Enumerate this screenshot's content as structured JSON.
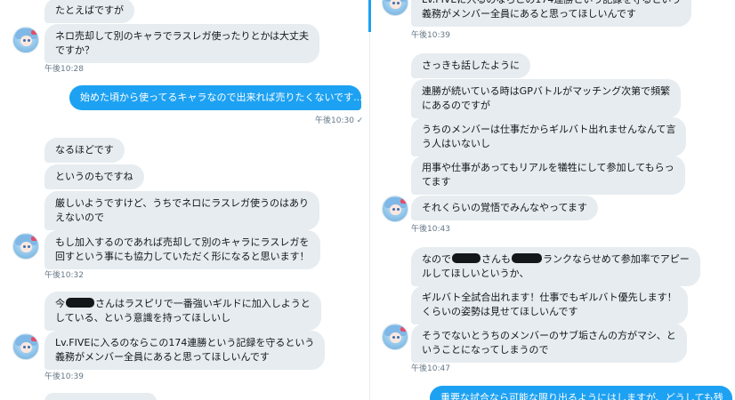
{
  "left_pane": {
    "messages": [
      {
        "lines": [
          "たとえばですが"
        ]
      },
      {
        "lines": [
          "ネロ売却して別のキャラでラスレガ使ったりとかは大丈夫",
          "ですか？"
        ]
      },
      {
        "time": "午後10:28"
      },
      {
        "lines": [
          "始めた頃から使ってるキャラなので出来れば売りたくないです..."
        ]
      },
      {
        "time": "午後10:30 ✓"
      },
      {
        "lines": [
          "なるほどです"
        ]
      },
      {
        "lines": [
          "というのもですね"
        ]
      },
      {
        "lines": [
          "厳しいようですけど、うちでネロにラスレガ使うのはあり",
          "えないので"
        ]
      },
      {
        "lines": [
          "もし加入するのであれば売却して別のキャラにラスレガを",
          "回すという事にも協力していただく形になると思います！"
        ]
      },
      {
        "time": "午後10:32"
      },
      {
        "line1_prefix": "今",
        "line1_suffix": "さんはラスピリで一番強いギルドに加入しようと",
        "line2": "している、という意識を持ってほしいし"
      },
      {
        "lines": [
          "Lv.FIVEに入るのならこの174連勝という記録を守るという",
          "義務がメンバー全員にあると思ってほしいんです"
        ]
      },
      {
        "time": "午後10:39"
      }
    ]
  },
  "right_pane": {
    "messages": [
      {
        "lines": [
          "Lv.FIVEに入るのならこの174連勝という記録を守るという",
          "義務がメンバー全員にあると思ってほしいんです"
        ]
      },
      {
        "time": "午後10:39"
      },
      {
        "lines": [
          "さっきも話したように"
        ]
      },
      {
        "lines": [
          "連勝が続いている時はGPバトルがマッチング次第で頻繁",
          "にあるのですが"
        ]
      },
      {
        "lines": [
          "うちのメンバーは仕事だからギルバト出れませんなんて言",
          "う人はいないし"
        ]
      },
      {
        "lines": [
          "用事や仕事があってもリアルを犠牲にして参加してもらっ",
          "てます"
        ]
      },
      {
        "lines": [
          "それくらいの覚悟でみんなやってます"
        ]
      },
      {
        "time": "午後10:43"
      },
      {
        "line1_prefix": "なので",
        "line1_mid": "さんも",
        "line1_suffix": "ランクならせめて参加率でアピー",
        "line2": "ルしてほしいというか、"
      },
      {
        "lines": [
          "ギルバト全試合出れます！仕事でもギルバト優先します！",
          "くらいの姿勢は見せてほしいんです"
        ]
      },
      {
        "lines": [
          "そうでないとうちのメンバーのサブ垢さんの方がマシ、と",
          "いうことになってしまうので"
        ]
      },
      {
        "time": "午後10:47"
      },
      {
        "lines": [
          "重要な試合なら可能な限り出るようにはしますが、どうしても残"
        ]
      }
    ]
  },
  "colors": {
    "incoming_bubble": "#e6ecf0",
    "outgoing_bubble": "#1da1f2",
    "timestamp": "#657786",
    "text": "#14171a"
  },
  "icons": {
    "avatar": "anime-character-avatar"
  }
}
